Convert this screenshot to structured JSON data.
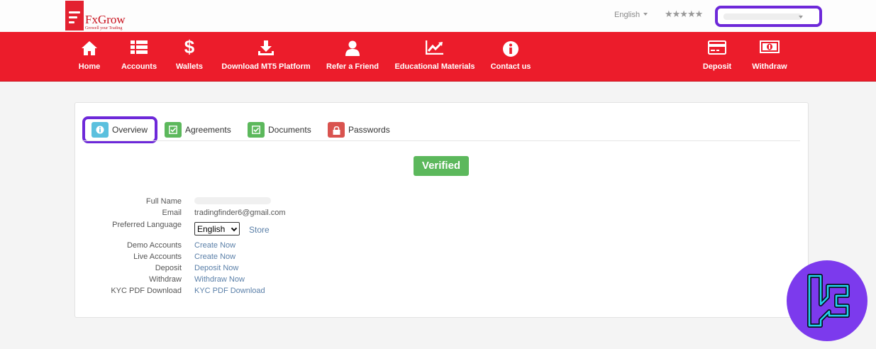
{
  "brand": {
    "name": "FxGrow",
    "tagline": "Growell your Trading"
  },
  "header": {
    "language": "English",
    "rating": "★★★★★",
    "account_selector": ""
  },
  "nav": {
    "left": [
      {
        "label": "Home",
        "icon": "home-icon"
      },
      {
        "label": "Accounts",
        "icon": "list-icon"
      },
      {
        "label": "Wallets",
        "icon": "dollar-icon"
      },
      {
        "label": "Download MT5 Platform",
        "icon": "download-icon"
      },
      {
        "label": "Refer a Friend",
        "icon": "user-icon"
      },
      {
        "label": "Educational Materials",
        "icon": "chart-icon"
      },
      {
        "label": "Contact us",
        "icon": "info-icon"
      }
    ],
    "right": [
      {
        "label": "Deposit",
        "icon": "card-icon"
      },
      {
        "label": "Withdraw",
        "icon": "money-icon"
      }
    ]
  },
  "tabs": [
    {
      "label": "Overview",
      "icon": "info-icon",
      "color": "#5bc0de",
      "active": true
    },
    {
      "label": "Agreements",
      "icon": "check-icon",
      "color": "#5cb85c"
    },
    {
      "label": "Documents",
      "icon": "check-icon",
      "color": "#5cb85c"
    },
    {
      "label": "Passwords",
      "icon": "lock-icon",
      "color": "#d9534f"
    }
  ],
  "status": {
    "verified": "Verified"
  },
  "profile": {
    "full_name_label": "Full Name",
    "email_label": "Email",
    "email_value": "tradingfinder6@gmail.com",
    "preferred_language_label": "Preferred Language",
    "preferred_language_value": "English",
    "store_label": "Store",
    "demo_accounts_label": "Demo Accounts",
    "demo_accounts_link": "Create Now",
    "live_accounts_label": "Live Accounts",
    "live_accounts_link": "Create Now",
    "deposit_label": "Deposit",
    "deposit_link": "Deposit Now",
    "withdraw_label": "Withdraw",
    "withdraw_link": "Withdraw Now",
    "kyc_label": "KYC PDF Download",
    "kyc_link": "KYC PDF Download"
  },
  "colors": {
    "nav_bg": "#ec1c2b",
    "highlight": "#6d28d9",
    "verified": "#5cb85c",
    "link": "#5a7fa8"
  }
}
